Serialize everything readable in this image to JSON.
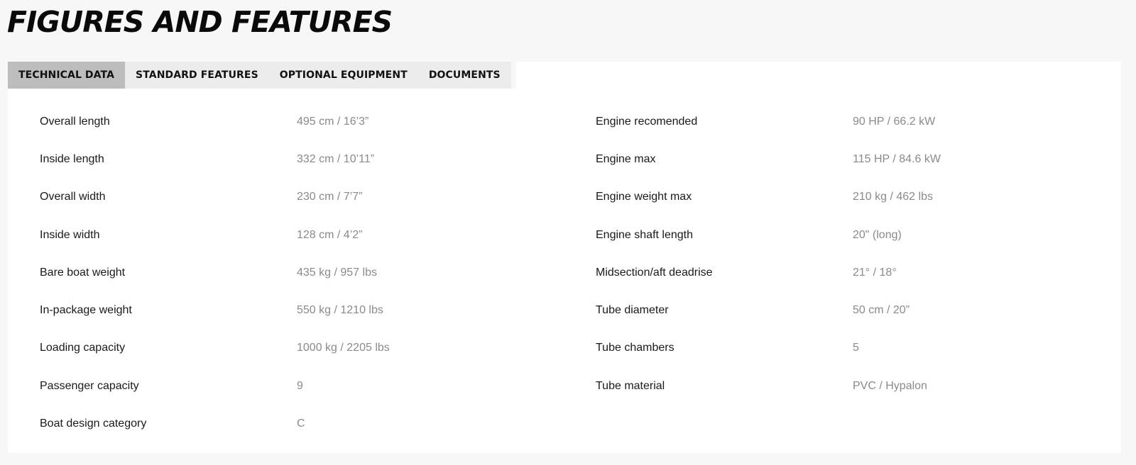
{
  "page": {
    "title": "FIGURES AND FEATURES"
  },
  "tabs": [
    {
      "label": "TECHNICAL DATA",
      "active": true
    },
    {
      "label": "STANDARD FEATURES",
      "active": false
    },
    {
      "label": "OPTIONAL EQUIPMENT",
      "active": false
    },
    {
      "label": "DOCUMENTS",
      "active": false
    }
  ],
  "specs": {
    "left": [
      {
        "label": "Overall length",
        "value": "495 cm / 16’3”"
      },
      {
        "label": "Inside length",
        "value": "332 cm / 10’11”"
      },
      {
        "label": "Overall width",
        "value": "230 cm / 7’7”"
      },
      {
        "label": "Inside width",
        "value": "128 cm / 4’2”"
      },
      {
        "label": "Bare boat weight",
        "value": "435 kg / 957 lbs"
      },
      {
        "label": "In-package weight",
        "value": "550 kg / 1210 lbs"
      },
      {
        "label": "Loading capacity",
        "value": "1000 kg / 2205 lbs"
      },
      {
        "label": "Passenger capacity",
        "value": "9"
      },
      {
        "label": "Boat design category",
        "value": "C"
      }
    ],
    "right": [
      {
        "label": "Engine recomended",
        "value": "90 HP / 66.2 kW"
      },
      {
        "label": "Engine max",
        "value": "115 HP / 84.6 kW"
      },
      {
        "label": "Engine weight max",
        "value": "210 kg / 462 lbs"
      },
      {
        "label": "Engine shaft length",
        "value": "20\" (long)"
      },
      {
        "label": "Midsection/aft deadrise",
        "value": "21° / 18°"
      },
      {
        "label": "Tube diameter",
        "value": "50 cm / 20”"
      },
      {
        "label": "Tube chambers",
        "value": "5"
      },
      {
        "label": "Tube material",
        "value": "PVC / Hypalon"
      }
    ]
  },
  "colors": {
    "background": "#f7f7f7",
    "active_tab": "#bdbdbd",
    "tab_bar": "#ececec",
    "label_text": "#1a1a1a",
    "value_text": "#8a8a8a"
  }
}
